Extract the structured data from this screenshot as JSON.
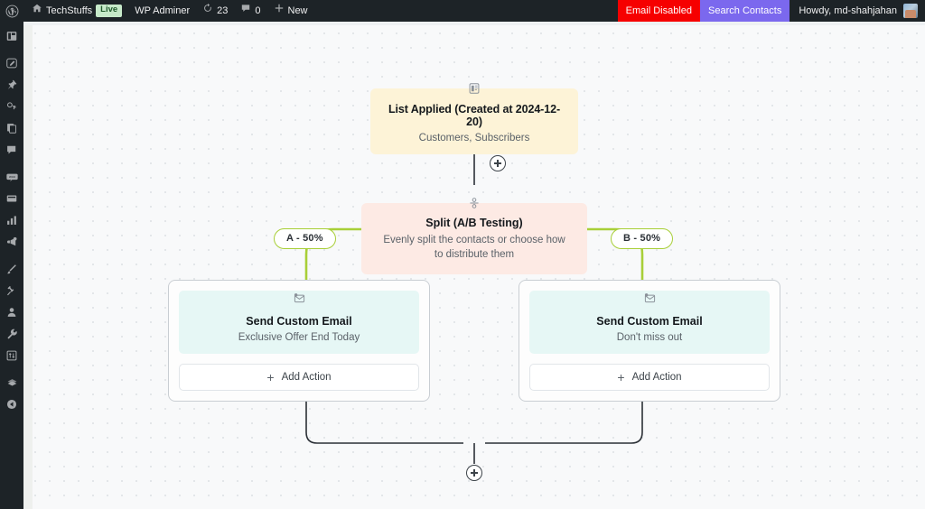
{
  "adminbar": {
    "logo_icon": "wordpress-logo-icon",
    "home_icon": "home-icon",
    "site_name": "TechStuffs",
    "live_badge": "Live",
    "wp_adminer": "WP Adminer",
    "updates_icon": "updates-icon",
    "updates_count": "23",
    "comments_icon": "comment-bubble-icon",
    "comments_count": "0",
    "new_icon": "plus-icon",
    "new_label": "New",
    "email_disabled": "Email Disabled",
    "search_contacts": "Search Contacts",
    "howdy": "Howdy, md-shahjahan",
    "avatar_icon": "user-avatar",
    "colors": {
      "bar_bg": "#1d2327",
      "email_disabled_bg": "#f60000",
      "search_contacts_bg": "#7b68ee",
      "live_badge_bg": "#c6e9c9"
    }
  },
  "sidebar": {
    "items": [
      {
        "icon": "dashboard-icon"
      },
      {
        "icon": "posts-icon"
      },
      {
        "icon": "media-pin-icon"
      },
      {
        "icon": "links-icon"
      },
      {
        "icon": "pages-icon"
      },
      {
        "icon": "comments-icon"
      },
      {
        "icon": "woo-icon"
      },
      {
        "icon": "products-icon"
      },
      {
        "icon": "analytics-icon"
      },
      {
        "icon": "marketing-megaphone-icon"
      },
      {
        "icon": "appearance-brush-icon"
      },
      {
        "icon": "plugins-plug-icon"
      },
      {
        "icon": "users-icon"
      },
      {
        "icon": "tools-wrench-icon"
      },
      {
        "icon": "settings-sliders-icon"
      },
      {
        "icon": "layers-icon"
      },
      {
        "icon": "collapse-icon"
      }
    ]
  },
  "flow": {
    "trigger": {
      "icon": "list-applied-icon",
      "title": "List Applied (Created at 2024-12-20)",
      "subtitle": "Customers, Subscribers",
      "bg": "#fdf3d7"
    },
    "split": {
      "icon": "split-branch-icon",
      "title": "Split (A/B Testing)",
      "subtitle": "Evenly split the contacts or choose how to distribute them",
      "bg": "#fdeae4"
    },
    "branches": [
      {
        "pill": "A - 50%",
        "icon": "send-email-icon",
        "title": "Send Custom Email",
        "subtitle": "Exclusive Offer End Today",
        "add_action": "Add Action",
        "add_icon": "plus-icon"
      },
      {
        "pill": "B - 50%",
        "icon": "send-email-icon",
        "title": "Send Custom Email",
        "subtitle": "Don't miss out",
        "add_action": "Add Action",
        "add_icon": "plus-icon"
      }
    ],
    "connectors": [
      {
        "name": "add-step-after-trigger",
        "icon": "plus-circle-icon"
      },
      {
        "name": "add-step-after-merge",
        "icon": "plus-circle-icon"
      }
    ],
    "colors": {
      "branch_line": "#a8cf38",
      "edge_line": "#2b3036",
      "email_card_bg": "#e6f7f5"
    }
  }
}
